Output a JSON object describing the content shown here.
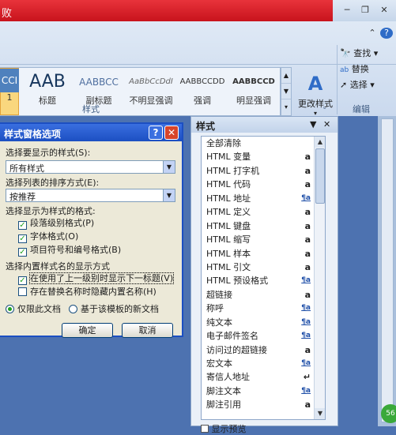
{
  "window": {
    "title_fragment": "败",
    "min": "─",
    "restore": "❐",
    "close": "✕",
    "help": "?",
    "up": "⌃"
  },
  "ribbon": {
    "gallery": [
      {
        "sample": "CCI",
        "caption": "1"
      },
      {
        "sample": "AAB",
        "caption": "标题"
      },
      {
        "sample": "AABBCC",
        "caption": "副标题"
      },
      {
        "sample": "AaBbCcDdI",
        "caption": "不明显强调"
      },
      {
        "sample": "AABBCCDD",
        "caption": "强调"
      },
      {
        "sample": "AABBCCD",
        "caption": "明显强调"
      }
    ],
    "change_styles_label": "更改样式",
    "change_styles_icon_text": "A",
    "styles_group_label": "样式",
    "find_label": "查找",
    "replace_label": "替换",
    "select_label": "选择",
    "editing_group_label": "编辑"
  },
  "styles_pane": {
    "title": "样式",
    "items": [
      {
        "name": "全部清除",
        "mark": ""
      },
      {
        "name": "HTML 变量",
        "mark": "a"
      },
      {
        "name": "HTML 打字机",
        "mark": "a"
      },
      {
        "name": "HTML 代码",
        "mark": "a"
      },
      {
        "name": "HTML 地址",
        "mark": "¶a"
      },
      {
        "name": "HTML 定义",
        "mark": "a"
      },
      {
        "name": "HTML 键盘",
        "mark": "a"
      },
      {
        "name": "HTML 缩写",
        "mark": "a"
      },
      {
        "name": "HTML 样本",
        "mark": "a"
      },
      {
        "name": "HTML 引文",
        "mark": "a"
      },
      {
        "name": "HTML 预设格式",
        "mark": "¶a"
      },
      {
        "name": "超链接",
        "mark": "a"
      },
      {
        "name": "称呼",
        "mark": "¶a"
      },
      {
        "name": "纯文本",
        "mark": "¶a"
      },
      {
        "name": "电子邮件签名",
        "mark": "¶a"
      },
      {
        "name": "访问过的超链接",
        "mark": "a"
      },
      {
        "name": "宏文本",
        "mark": "¶a"
      },
      {
        "name": "寄信人地址",
        "mark": "↵"
      },
      {
        "name": "脚注文本",
        "mark": "¶a"
      },
      {
        "name": "脚注引用",
        "mark": "a"
      }
    ],
    "show_preview_label": "显示预览"
  },
  "dialog": {
    "title": "样式窗格选项",
    "show_styles_label": "选择要显示的样式(S):",
    "show_styles_value": "所有样式",
    "sort_label": "选择列表的排序方式(E):",
    "sort_value": "按推荐",
    "format_group_label": "选择显示为样式的格式:",
    "cb_paragraph": "段落级别格式(P)",
    "cb_font": "字体格式(O)",
    "cb_bullets": "项目符号和编号格式(B)",
    "builtin_group_label": "选择内置样式名的显示方式",
    "cb_next_heading": "在使用了上一级别时显示下一标题(V)",
    "cb_hide_builtin": "存在替换名称时隐藏内置名称(H)",
    "radio_this_doc": "仅限此文档",
    "radio_template": "基于该模板的新文档",
    "ok": "确定",
    "cancel": "取消"
  },
  "status_badge": "56"
}
